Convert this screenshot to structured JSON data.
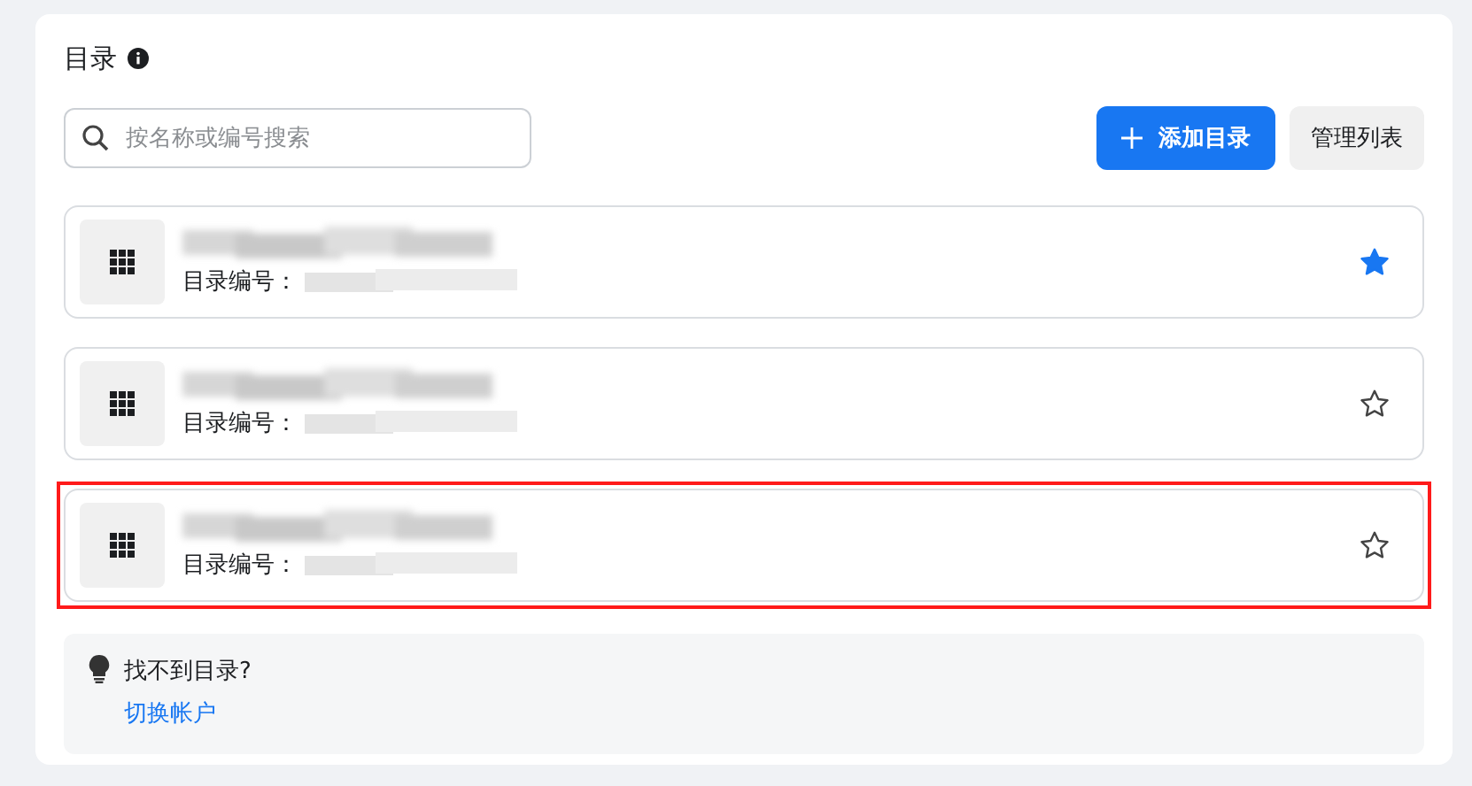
{
  "panel": {
    "title": "目录"
  },
  "search": {
    "placeholder": "按名称或编号搜索"
  },
  "buttons": {
    "add": "添加目录",
    "manage": "管理列表"
  },
  "catalogs": [
    {
      "id_label": "目录编号：",
      "starred": true,
      "highlighted": false
    },
    {
      "id_label": "目录编号：",
      "starred": false,
      "highlighted": false
    },
    {
      "id_label": "目录编号：",
      "starred": false,
      "highlighted": true
    }
  ],
  "help": {
    "text": "找不到目录?",
    "link": "切换帐户"
  }
}
